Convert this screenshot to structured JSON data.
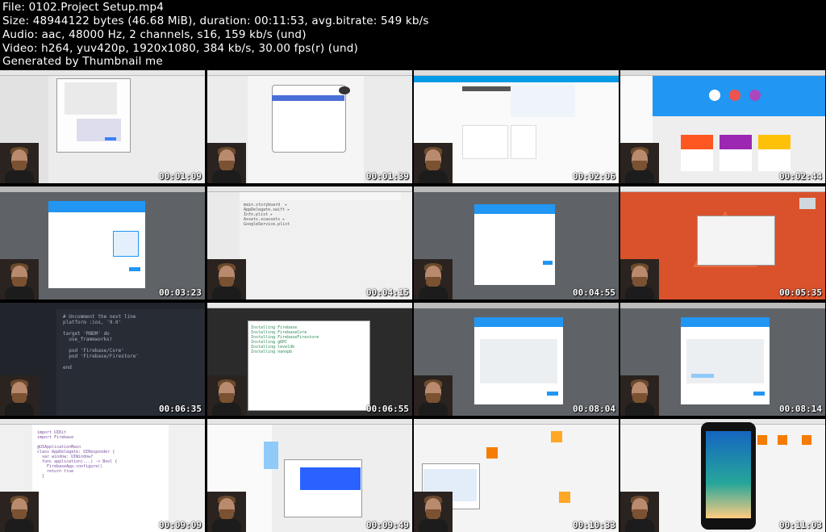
{
  "header": {
    "lines": [
      "File: 0102.Project Setup.mp4",
      "Size: 48944122 bytes (46.68 MiB), duration: 00:11:53, avg.bitrate: 549 kb/s",
      "Audio: aac, 48000 Hz, 2 channels, s16, 159 kb/s (und)",
      "Video: h264, yuv420p, 1920x1080, 384 kb/s, 30.00 fps(r) (und)",
      "Generated by Thumbnail me"
    ]
  },
  "thumbnails": [
    {
      "timestamp": "00:01:09",
      "scene": "xcode-new-project",
      "bg": "#ececec"
    },
    {
      "timestamp": "00:01:39",
      "scene": "xcode-autocomplete",
      "bg": "#f5f5f5"
    },
    {
      "timestamp": "00:02:06",
      "scene": "firebase-welcome",
      "bg": "#fafafa"
    },
    {
      "timestamp": "00:02:44",
      "scene": "firebase-overview",
      "bg": "#eeeeee"
    },
    {
      "timestamp": "00:03:23",
      "scene": "firebase-add-ios",
      "bg": "#5f6368"
    },
    {
      "timestamp": "00:04:15",
      "scene": "xcode-project",
      "bg": "#f0f0f0"
    },
    {
      "timestamp": "00:04:55",
      "scene": "firebase-dialog",
      "bg": "#5f6368"
    },
    {
      "timestamp": "00:05:35",
      "scene": "desktop-finder",
      "bg": "#d9522c"
    },
    {
      "timestamp": "00:06:35",
      "scene": "atom-podfile",
      "bg": "#282c34"
    },
    {
      "timestamp": "00:06:55",
      "scene": "terminal-pod-install",
      "bg": "#2b2b2b"
    },
    {
      "timestamp": "00:08:04",
      "scene": "firebase-code",
      "bg": "#5f6368"
    },
    {
      "timestamp": "00:08:14",
      "scene": "firebase-code-2",
      "bg": "#5f6368"
    },
    {
      "timestamp": "00:09:09",
      "scene": "xcode-appdelegate",
      "bg": "#ffffff"
    },
    {
      "timestamp": "00:09:49",
      "scene": "finder-files",
      "bg": "#eeeeee"
    },
    {
      "timestamp": "00:10:33",
      "scene": "storyboard-drag",
      "bg": "#f4f4f4"
    },
    {
      "timestamp": "00:11:03",
      "scene": "ios-simulator",
      "bg": "#f4f4f4"
    }
  ],
  "colors": {
    "firebase_blue": "#039be5",
    "firebase_header": "#2196f3",
    "atom_bg": "#282c34",
    "desktop_orange": "#d9522c"
  },
  "icons": [
    "user-webcam-icon"
  ]
}
